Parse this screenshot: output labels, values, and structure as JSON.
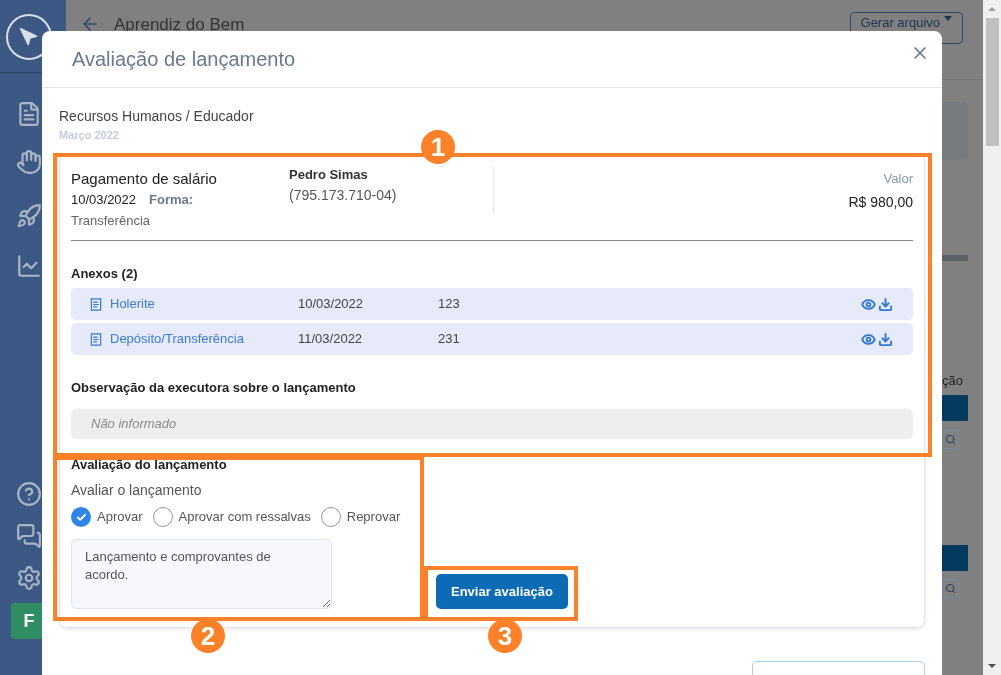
{
  "sidebar": {
    "badge": "F"
  },
  "header": {
    "title": "Aprendiz do Bem",
    "button": "Gerar arquivo"
  },
  "background": {
    "column_fragment": "ção"
  },
  "modal": {
    "title": "Avaliação de lançamento",
    "breadcrumb": "Recursos Humanos / Educador",
    "period": "Março 2022",
    "entry": {
      "title": "Pagamento de salário",
      "date": "10/03/2022",
      "method_label": "Forma:",
      "method": "Transferência",
      "person": "Pedro Simas",
      "person_id": "(795.173.710-04)",
      "value_label": "Valor",
      "value": "R$ 980,00"
    },
    "attachments": {
      "title": "Anexos (2)",
      "items": [
        {
          "name": "Holerite",
          "date": "10/03/2022",
          "number": "123"
        },
        {
          "name": "Depósito/Transferência",
          "date": "11/03/2022",
          "number": "231"
        }
      ]
    },
    "observation": {
      "title": "Observação da executora sobre o lançamento",
      "text": "Não informado"
    },
    "evaluation": {
      "title": "Avaliação do lançamento",
      "prompt": "Avaliar o lançamento",
      "options": [
        {
          "label": "Aprovar",
          "selected": true
        },
        {
          "label": "Aprovar com ressalvas",
          "selected": false
        },
        {
          "label": "Reprovar",
          "selected": false
        }
      ],
      "comment": "Lançamento e comprovantes de acordo.",
      "submit": "Enviar avaliação"
    }
  },
  "annotations": [
    {
      "label": "1"
    },
    {
      "label": "2"
    },
    {
      "label": "3"
    }
  ]
}
